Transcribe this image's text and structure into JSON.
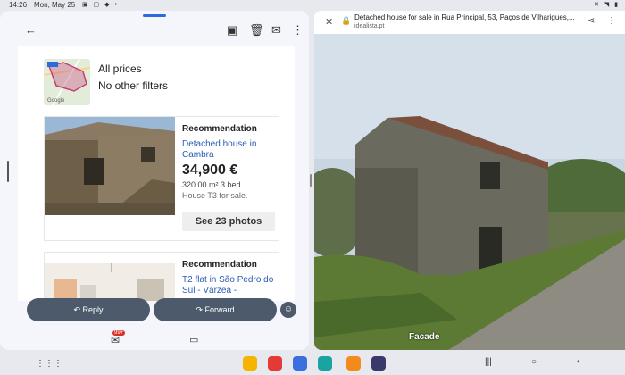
{
  "status": {
    "time": "14:26",
    "date": "Mon, May 25"
  },
  "email": {
    "map_badge": "Google",
    "filters": [
      "All prices",
      "No other filters"
    ],
    "listings": [
      {
        "label": "Recommendation",
        "title": "Detached house in Cambra",
        "price": "34,900 €",
        "meta": "320.00 m² 3 bed",
        "desc": "House T3 for sale.",
        "photos_button": "See 23 photos"
      },
      {
        "label": "Recommendation",
        "title": "T2 flat in São Pedro do Sul - Várzea - "
      }
    ],
    "reply_label": "Reply",
    "forward_label": "Forward",
    "badge": "99+"
  },
  "browser": {
    "page_title": "Detached house for sale in Rua Principal, 53, Paços de Vilharigues,...",
    "domain": "idealista.pt",
    "photo_caption": "Facade"
  },
  "colors": {
    "accent": "#2a5db0",
    "pill": "#4c5a6b",
    "badge": "#d93025"
  }
}
